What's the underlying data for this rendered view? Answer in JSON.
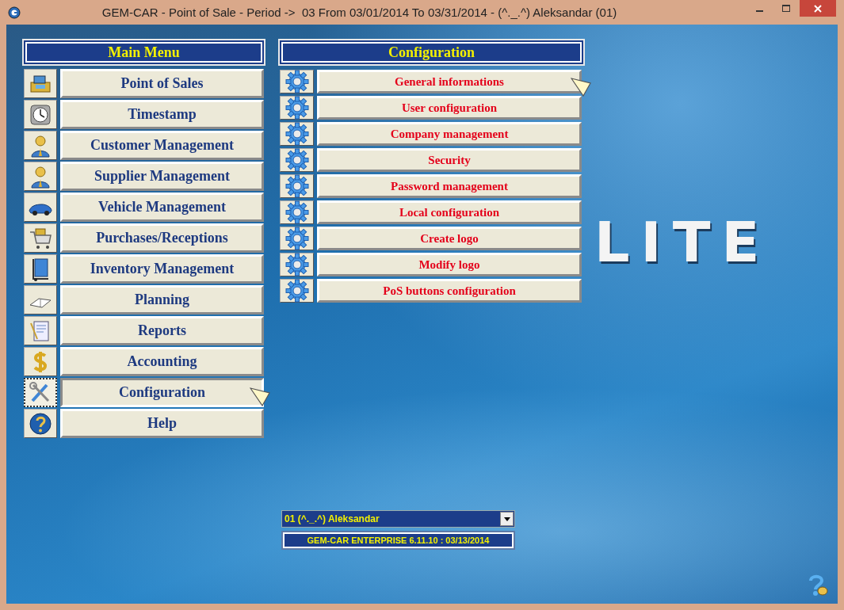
{
  "window": {
    "title": "GEM-CAR - Point of Sale - Period ->  03 From 03/01/2014 To 03/31/2014 - (^._.^) Aleksandar (01)"
  },
  "main_menu": {
    "title": "Main Menu",
    "items": [
      {
        "label": "Point of Sales",
        "selected": false,
        "hovered": false
      },
      {
        "label": "Timestamp",
        "selected": false,
        "hovered": false
      },
      {
        "label": "Customer Management",
        "selected": false,
        "hovered": false
      },
      {
        "label": "Supplier Management",
        "selected": false,
        "hovered": false
      },
      {
        "label": "Vehicle Management",
        "selected": false,
        "hovered": false
      },
      {
        "label": "Purchases/Receptions",
        "selected": false,
        "hovered": false
      },
      {
        "label": "Inventory Management",
        "selected": false,
        "hovered": false
      },
      {
        "label": "Planning",
        "selected": false,
        "hovered": false
      },
      {
        "label": "Reports",
        "selected": false,
        "hovered": false
      },
      {
        "label": "Accounting",
        "selected": false,
        "hovered": false
      },
      {
        "label": "Configuration",
        "selected": true,
        "hovered": true
      },
      {
        "label": "Help",
        "selected": false,
        "hovered": false
      }
    ]
  },
  "configuration_menu": {
    "title": "Configuration",
    "items": [
      {
        "label": "General informations",
        "hovered": true
      },
      {
        "label": "User configuration",
        "hovered": false
      },
      {
        "label": "Company management",
        "hovered": false
      },
      {
        "label": "Security",
        "hovered": false
      },
      {
        "label": "Password management",
        "hovered": false
      },
      {
        "label": "Local configuration",
        "hovered": false
      },
      {
        "label": "Create logo",
        "hovered": false
      },
      {
        "label": "Modify logo",
        "hovered": false
      },
      {
        "label": "PoS buttons configuration",
        "hovered": false
      }
    ]
  },
  "background_logo": "LITE",
  "user_select": {
    "value": "01 (^._.^) Aleksandar"
  },
  "version": "GEM-CAR ENTERPRISE 6.11.10 : 03/13/2014"
}
